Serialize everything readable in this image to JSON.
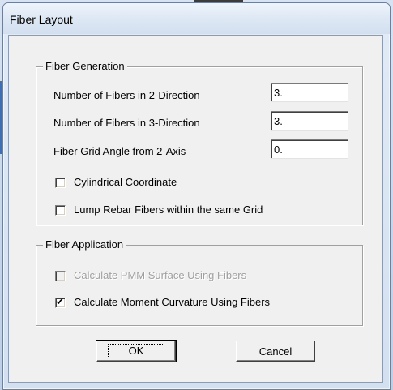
{
  "window": {
    "title": "Fiber Layout"
  },
  "fiber_generation": {
    "group_label": "Fiber Generation",
    "fibers_2dir_label": "Number of Fibers in 2-Direction",
    "fibers_2dir_value": "3.",
    "fibers_3dir_label": "Number of Fibers in 3-Direction",
    "fibers_3dir_value": "3.",
    "grid_angle_label": "Fiber Grid Angle from 2-Axis",
    "grid_angle_value": "0.",
    "cylindrical_label": "Cylindrical Coordinate",
    "cylindrical_checked": false,
    "lump_rebar_label": "Lump Rebar Fibers within the same Grid",
    "lump_rebar_checked": false
  },
  "fiber_application": {
    "group_label": "Fiber Application",
    "pmm_label": "Calculate PMM Surface Using Fibers",
    "pmm_checked": false,
    "pmm_enabled": false,
    "moment_curvature_label": "Calculate Moment Curvature Using Fibers",
    "moment_curvature_checked": true,
    "checkmark_glyph": "✔"
  },
  "buttons": {
    "ok_label": "OK",
    "cancel_label": "Cancel"
  },
  "colors": {
    "disabled_text": "#a0a0a0",
    "window_frame": "#d3e0f0",
    "dialog_face": "#f0f0f0"
  }
}
